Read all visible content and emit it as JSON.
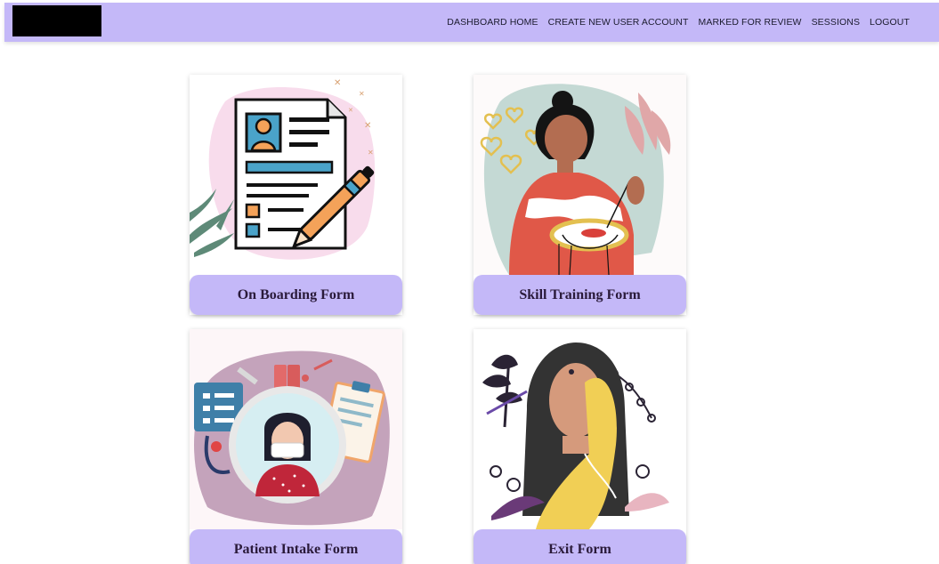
{
  "nav": {
    "links": [
      "DASHBOARD HOME",
      "CREATE NEW USER ACCOUNT",
      "MARKED FOR REVIEW",
      "SESSIONS",
      "LOGOUT"
    ]
  },
  "cards": [
    {
      "title": "On Boarding Form",
      "illustration": "document-pen-icon"
    },
    {
      "title": "Skill Training Form",
      "illustration": "embroidery-woman-icon"
    },
    {
      "title": "Patient Intake Form",
      "illustration": "masked-patient-icon"
    },
    {
      "title": "Exit Form",
      "illustration": "woman-saree-icon"
    }
  ],
  "colors": {
    "navbar": "#c4b8f8",
    "card_label": "#c4b8f8",
    "text": "#2a1a3a"
  }
}
